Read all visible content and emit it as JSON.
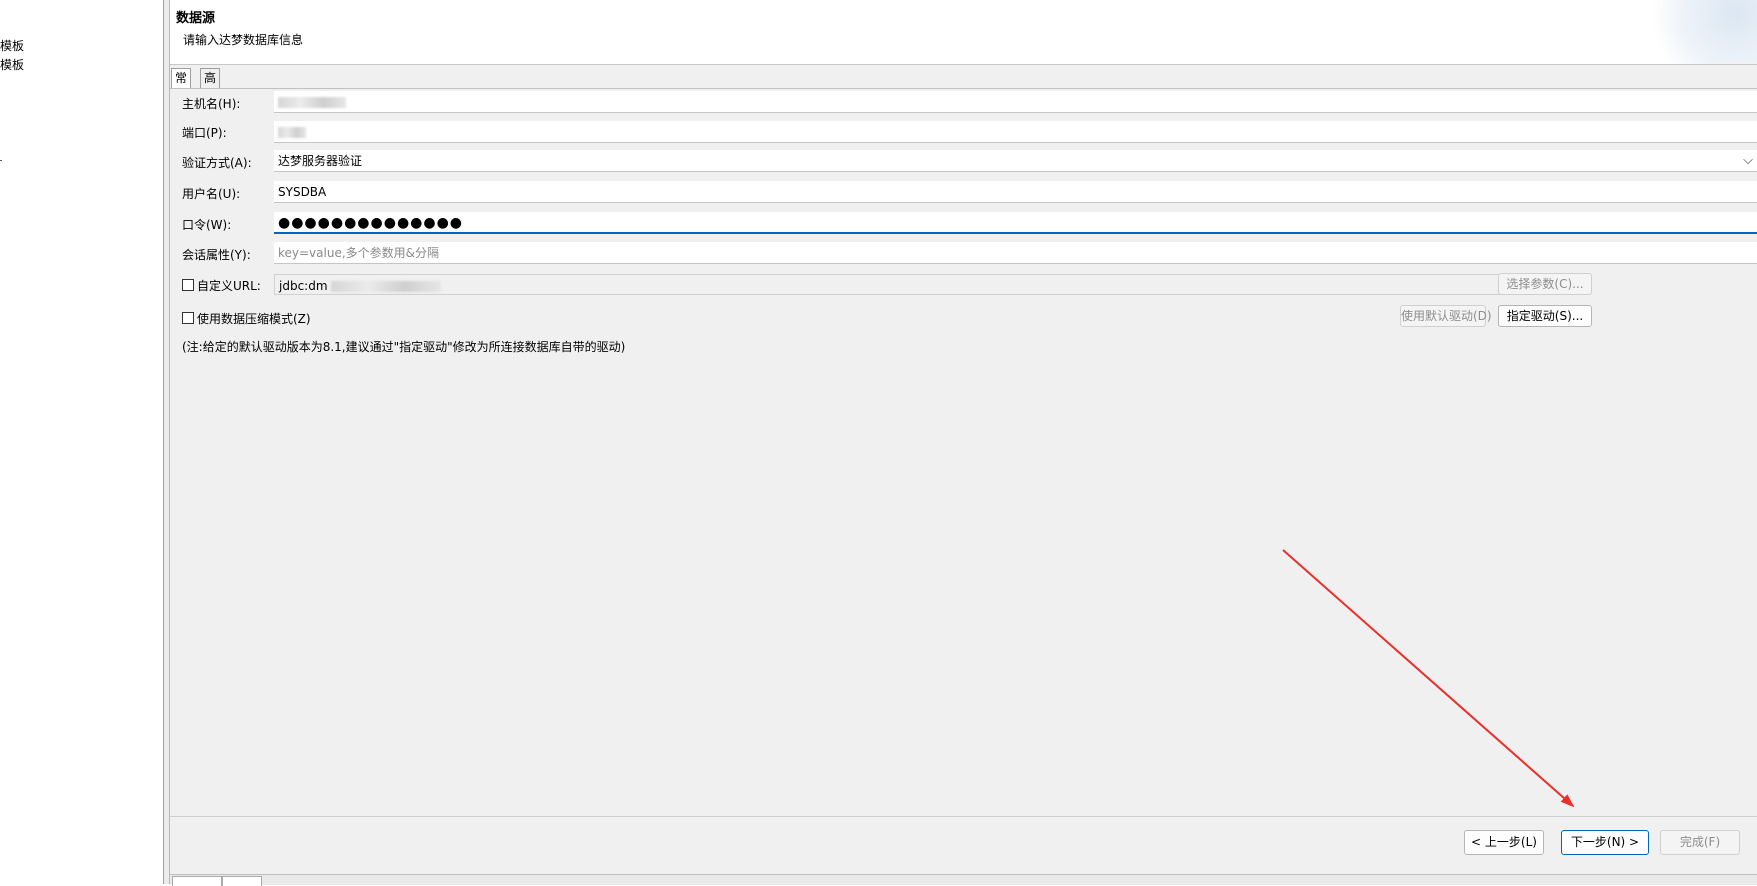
{
  "left_pane": {
    "items": [
      "模板",
      "模板"
    ]
  },
  "header": {
    "title": "数据源",
    "subtitle": "请输入达梦数据库信息"
  },
  "tabs": [
    {
      "label": "常规",
      "active": true
    },
    {
      "label": "高级",
      "active": false
    }
  ],
  "form": {
    "host_label": "主机名(H):",
    "host_value": "",
    "port_label": "端口(P):",
    "port_value": "",
    "auth_label": "验证方式(A):",
    "auth_value": "达梦服务器验证",
    "user_label": "用户名(U):",
    "user_value": "SYSDBA",
    "password_label": "口令(W):",
    "password_value": "●●●●●●●●●●●●●●",
    "session_label": "会话属性(Y):",
    "session_placeholder": "key=value,多个参数用&分隔",
    "custom_url_label": "自定义URL:",
    "custom_url_value": "jdbc:dm",
    "custom_url_checked": false,
    "choose_params_label": "选择参数(C)...",
    "compress_label": "使用数据压缩模式(Z)",
    "compress_checked": false,
    "default_driver_label": "使用默认驱动(D)",
    "specify_driver_label": "指定驱动(S)...",
    "note": "(注:给定的默认驱动版本为8.1,建议通过\"指定驱动\"修改为所连接数据库自带的驱动)"
  },
  "buttons": {
    "back": "< 上一步(L)",
    "next": "下一步(N) >",
    "finish": "完成(F)"
  },
  "annotation": {
    "arrow_color": "#e8312a"
  }
}
